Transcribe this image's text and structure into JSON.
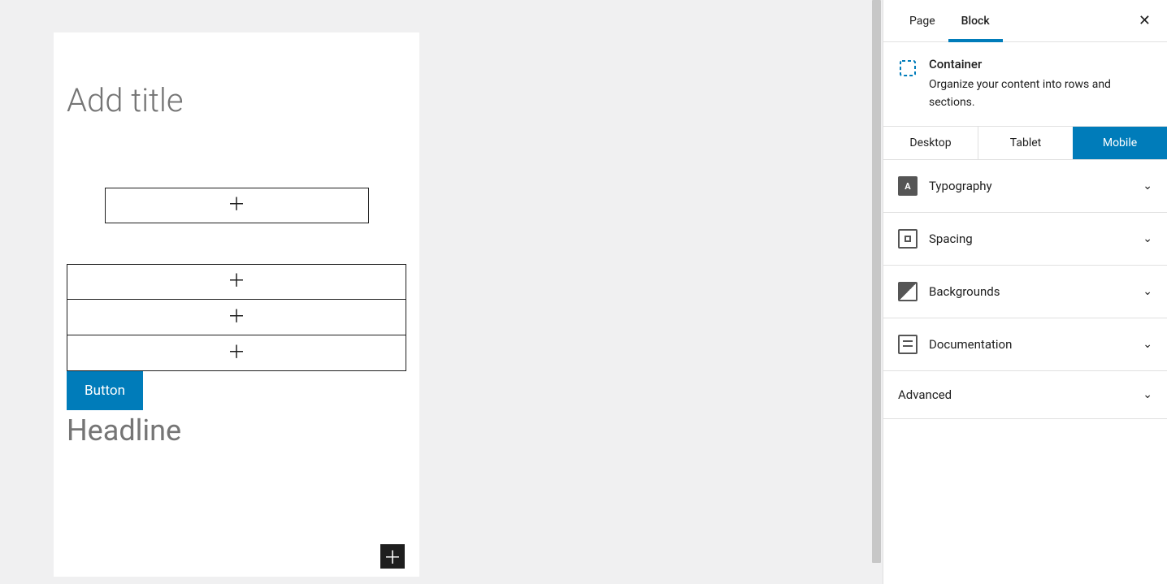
{
  "editor": {
    "title_placeholder": "Add title",
    "single_box_label": "",
    "grid_boxes": [
      "",
      "",
      ""
    ],
    "button_label": "Button",
    "headline_text": "Headline"
  },
  "sidebar": {
    "tabs": {
      "page": "Page",
      "block": "Block",
      "active": "block"
    },
    "block_info": {
      "name": "Container",
      "description": "Organize your content into rows and sections."
    },
    "device_tabs": {
      "desktop": "Desktop",
      "tablet": "Tablet",
      "mobile": "Mobile",
      "active": "mobile"
    },
    "panels": [
      {
        "key": "typography",
        "label": "Typography"
      },
      {
        "key": "spacing",
        "label": "Spacing"
      },
      {
        "key": "backgrounds",
        "label": "Backgrounds"
      },
      {
        "key": "documentation",
        "label": "Documentation"
      },
      {
        "key": "advanced",
        "label": "Advanced"
      }
    ]
  }
}
